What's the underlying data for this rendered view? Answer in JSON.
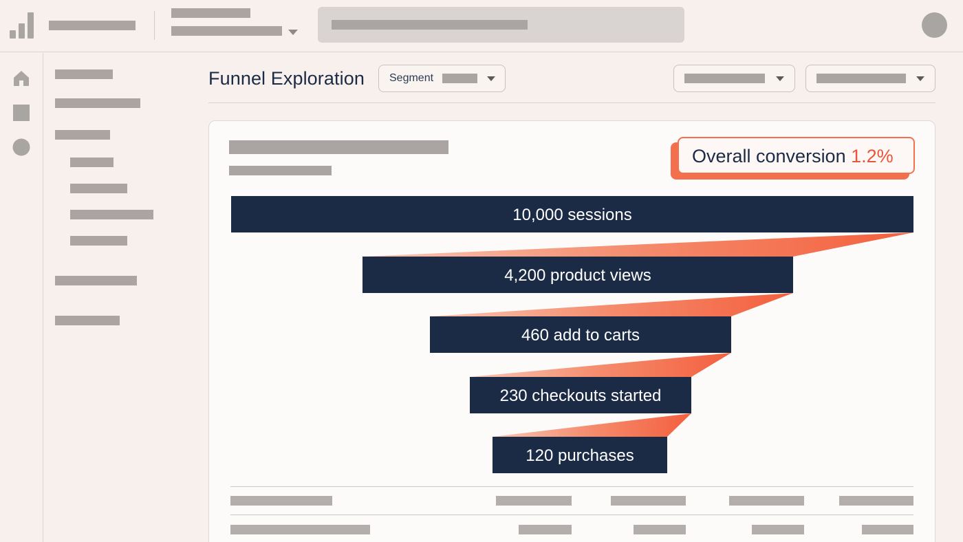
{
  "page": {
    "title": "Funnel Exploration"
  },
  "segment_dropdown": {
    "label": "Segment"
  },
  "summary_badge": {
    "label": "Overall conversion",
    "value": "1.2%"
  },
  "colors": {
    "stage_fill": "#1c2b45",
    "flow_accent": "#f36b4a",
    "background": "#f8f0ec"
  },
  "rail_icons": [
    "home-icon",
    "square-icon",
    "circle-icon"
  ],
  "chart_data": {
    "type": "funnel",
    "stages": [
      {
        "label": "10,000 sessions",
        "value": 10000
      },
      {
        "label": "4,200 product views",
        "value": 4200
      },
      {
        "label": "460 add to carts",
        "value": 460
      },
      {
        "label": "230 checkouts started",
        "value": 230
      },
      {
        "label": "120 purchases",
        "value": 120
      }
    ]
  }
}
